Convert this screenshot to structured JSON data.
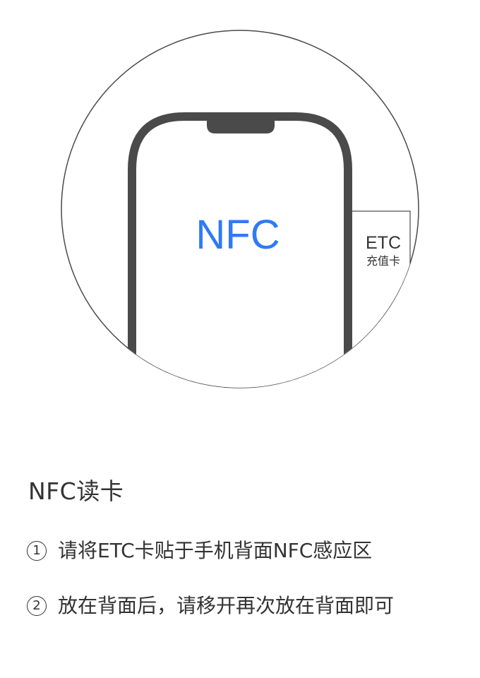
{
  "illustration": {
    "nfc_label": "NFC",
    "card": {
      "title": "ETC",
      "subtitle": "充值卡"
    },
    "nfc_color": "#2F7AF6"
  },
  "title": "NFC读卡",
  "steps": [
    {
      "number": "1",
      "text": "请将ETC卡贴于手机背面NFC感应区"
    },
    {
      "number": "2",
      "text": "放在背面后，请移开再次放在背面即可"
    }
  ]
}
